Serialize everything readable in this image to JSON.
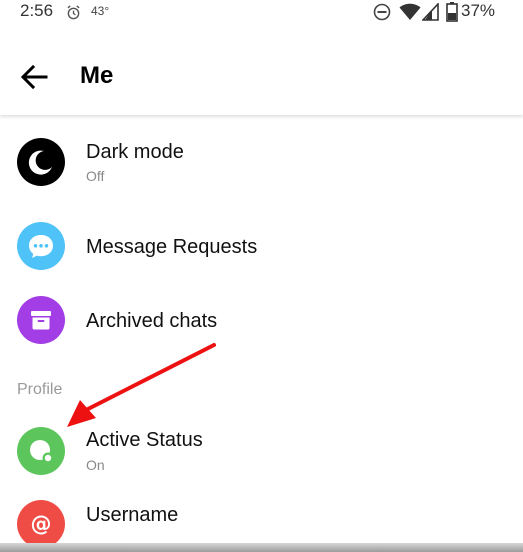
{
  "status_bar": {
    "time": "2:56",
    "temperature": "43°",
    "battery": "37%",
    "icons": [
      "alarm-icon",
      "do-not-disturb-icon",
      "wifi-icon",
      "signal-icon",
      "battery-icon"
    ]
  },
  "header": {
    "title": "Me",
    "back_icon": "arrow-left-icon"
  },
  "items": [
    {
      "label": "Dark mode",
      "sub": "Off",
      "icon": "moon-icon",
      "color": "#000000"
    },
    {
      "label": "Message Requests",
      "icon": "chat-bubble-icon",
      "color": "#4fc3f7"
    },
    {
      "label": "Archived chats",
      "icon": "archive-box-icon",
      "color": "#a33ee6"
    }
  ],
  "profile_section": {
    "header": "Profile",
    "items": [
      {
        "label": "Active Status",
        "sub": "On",
        "icon": "active-status-icon",
        "color": "#5cc65c"
      },
      {
        "label": "Username",
        "icon": "at-sign-icon",
        "color": "#ef4c45"
      }
    ]
  },
  "annotation": {
    "arrow_color": "#ee1111",
    "points_to": "Active Status"
  }
}
